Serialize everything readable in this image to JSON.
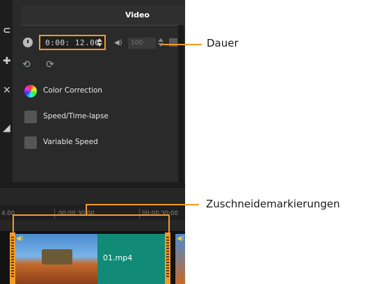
{
  "panel": {
    "title": "Video",
    "duration": "0:00: 12.00",
    "volume": "100"
  },
  "options": [
    {
      "label": "Color Correction",
      "icon": "color-wheel-icon"
    },
    {
      "label": "Speed/Time-lapse",
      "icon": "speedometer-icon"
    },
    {
      "label": "Variable Speed",
      "icon": "variable-speed-icon"
    }
  ],
  "timeline": {
    "ruler_left": "4:00",
    "ruler_mid": "00:00:30:00",
    "ruler_right": "00:00:30:00",
    "clip_name": "01.mp4"
  },
  "callouts": {
    "duration": "Dauer",
    "trim": "Zuschneidemarkierungen"
  },
  "colors": {
    "accent": "#f59a23",
    "panel": "#2a2a2a",
    "clip": "#128a78"
  }
}
